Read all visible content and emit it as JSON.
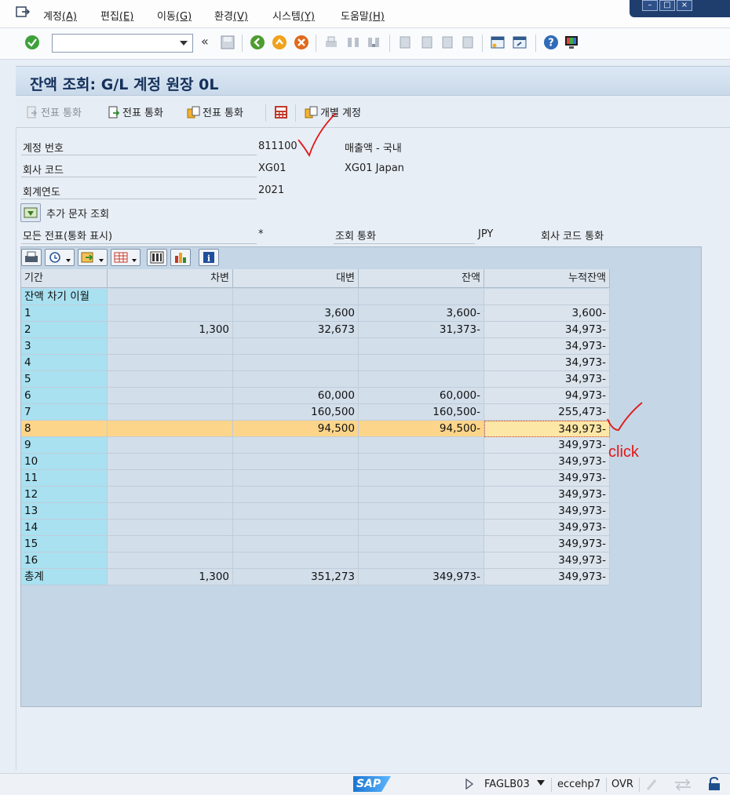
{
  "menu": [
    {
      "label": "계정",
      "key": "(A)"
    },
    {
      "label": "편집",
      "key": "(E)"
    },
    {
      "label": "이동",
      "key": "(G)"
    },
    {
      "label": "환경",
      "key": "(V)"
    },
    {
      "label": "시스템",
      "key": "(Y)"
    },
    {
      "label": "도움말",
      "key": "(H)"
    }
  ],
  "title": "잔액 조회: G/L 계정 원장 0L",
  "app_toolbar": {
    "btn1": "전표 통화",
    "btn2": "전표 통화",
    "btn3": "전표 통화",
    "btn4": "개별 계정"
  },
  "header": {
    "account_label": "계정 번호",
    "account_value": "811100",
    "account_desc": "매출액 - 국내",
    "company_label": "회사 코드",
    "company_value": "XG01",
    "company_desc": "XG01 Japan",
    "year_label": "회계연도",
    "year_value": "2021",
    "add_doc_label": "추가 문자 조회",
    "all_docs_label": "모든 전표(통화 표시)",
    "all_docs_value": "*",
    "display_currency_label": "조회 통화",
    "display_currency_value": "JPY",
    "company_currency_label": "회사 코드 통화"
  },
  "grid": {
    "columns": [
      "기간",
      "차변",
      "대변",
      "잔액",
      "누적잔액"
    ],
    "rows": [
      {
        "period": "잔액 차기 이월",
        "debit": "",
        "credit": "",
        "balance": "",
        "cumulative": ""
      },
      {
        "period": "1",
        "debit": "",
        "credit": "3,600",
        "balance": "3,600-",
        "cumulative": "3,600-"
      },
      {
        "period": "2",
        "debit": "1,300",
        "credit": "32,673",
        "balance": "31,373-",
        "cumulative": "34,973-"
      },
      {
        "period": "3",
        "debit": "",
        "credit": "",
        "balance": "",
        "cumulative": "34,973-"
      },
      {
        "period": "4",
        "debit": "",
        "credit": "",
        "balance": "",
        "cumulative": "34,973-"
      },
      {
        "period": "5",
        "debit": "",
        "credit": "",
        "balance": "",
        "cumulative": "34,973-"
      },
      {
        "period": "6",
        "debit": "",
        "credit": "60,000",
        "balance": "60,000-",
        "cumulative": "94,973-"
      },
      {
        "period": "7",
        "debit": "",
        "credit": "160,500",
        "balance": "160,500-",
        "cumulative": "255,473-"
      },
      {
        "period": "8",
        "debit": "",
        "credit": "94,500",
        "balance": "94,500-",
        "cumulative": "349,973-"
      },
      {
        "period": "9",
        "debit": "",
        "credit": "",
        "balance": "",
        "cumulative": "349,973-"
      },
      {
        "period": "10",
        "debit": "",
        "credit": "",
        "balance": "",
        "cumulative": "349,973-"
      },
      {
        "period": "11",
        "debit": "",
        "credit": "",
        "balance": "",
        "cumulative": "349,973-"
      },
      {
        "period": "12",
        "debit": "",
        "credit": "",
        "balance": "",
        "cumulative": "349,973-"
      },
      {
        "period": "13",
        "debit": "",
        "credit": "",
        "balance": "",
        "cumulative": "349,973-"
      },
      {
        "period": "14",
        "debit": "",
        "credit": "",
        "balance": "",
        "cumulative": "349,973-"
      },
      {
        "period": "15",
        "debit": "",
        "credit": "",
        "balance": "",
        "cumulative": "349,973-"
      },
      {
        "period": "16",
        "debit": "",
        "credit": "",
        "balance": "",
        "cumulative": "349,973-"
      },
      {
        "period": "총계",
        "debit": "1,300",
        "credit": "351,273",
        "balance": "349,973-",
        "cumulative": "349,973-"
      }
    ],
    "selected_row_index": 8
  },
  "annotation": {
    "click": "click"
  },
  "status": {
    "sap": "SAP",
    "tcode": "FAGLB03",
    "server": "eccehp7",
    "mode": "OVR"
  },
  "colors": {
    "selected_row": "#fcd58a",
    "key_column": "#a9e1f1",
    "annotation": "#e01818"
  }
}
